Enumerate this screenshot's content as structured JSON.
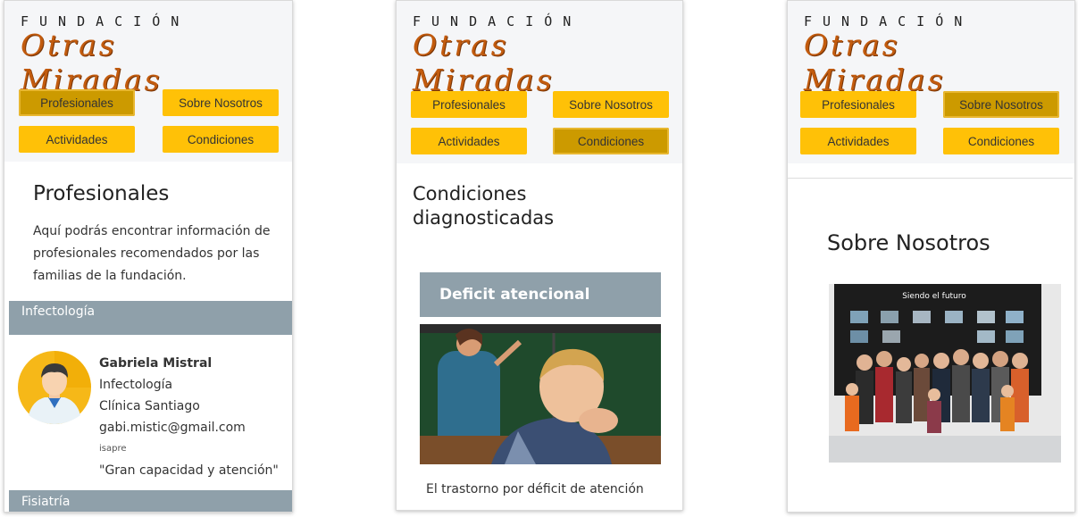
{
  "logo": {
    "top": "FUNDACIÓN",
    "main": "Otras Miradas"
  },
  "nav": {
    "profesionales": "Profesionales",
    "sobre_nosotros": "Sobre Nosotros",
    "actividades": "Actividades",
    "condiciones": "Condiciones"
  },
  "screen1": {
    "title": "Profesionales",
    "intro": "Aquí podrás encontrar información de profesionales recomendados por las familias de la fundación.",
    "category1": "Infectología",
    "card": {
      "name": "Gabriela Mistral",
      "specialty": "Infectología",
      "clinic": "Clínica Santiago",
      "email": "gabi.mistic@gmail.com",
      "insurance": "isapre",
      "review": "\"Gran capacidad y atención\""
    },
    "category2": "Fisiatría"
  },
  "screen2": {
    "title": "Condiciones diagnosticadas",
    "section": "Deficit atencional",
    "text": "El trastorno por déficit de atención"
  },
  "screen3": {
    "title": "Sobre Nosotros",
    "photo_caption": "Siendo el futuro"
  },
  "colors": {
    "button": "#ffc107",
    "button_active": "#cc9a00",
    "category": "#8fa0aa",
    "logo": "#c25b0e"
  }
}
